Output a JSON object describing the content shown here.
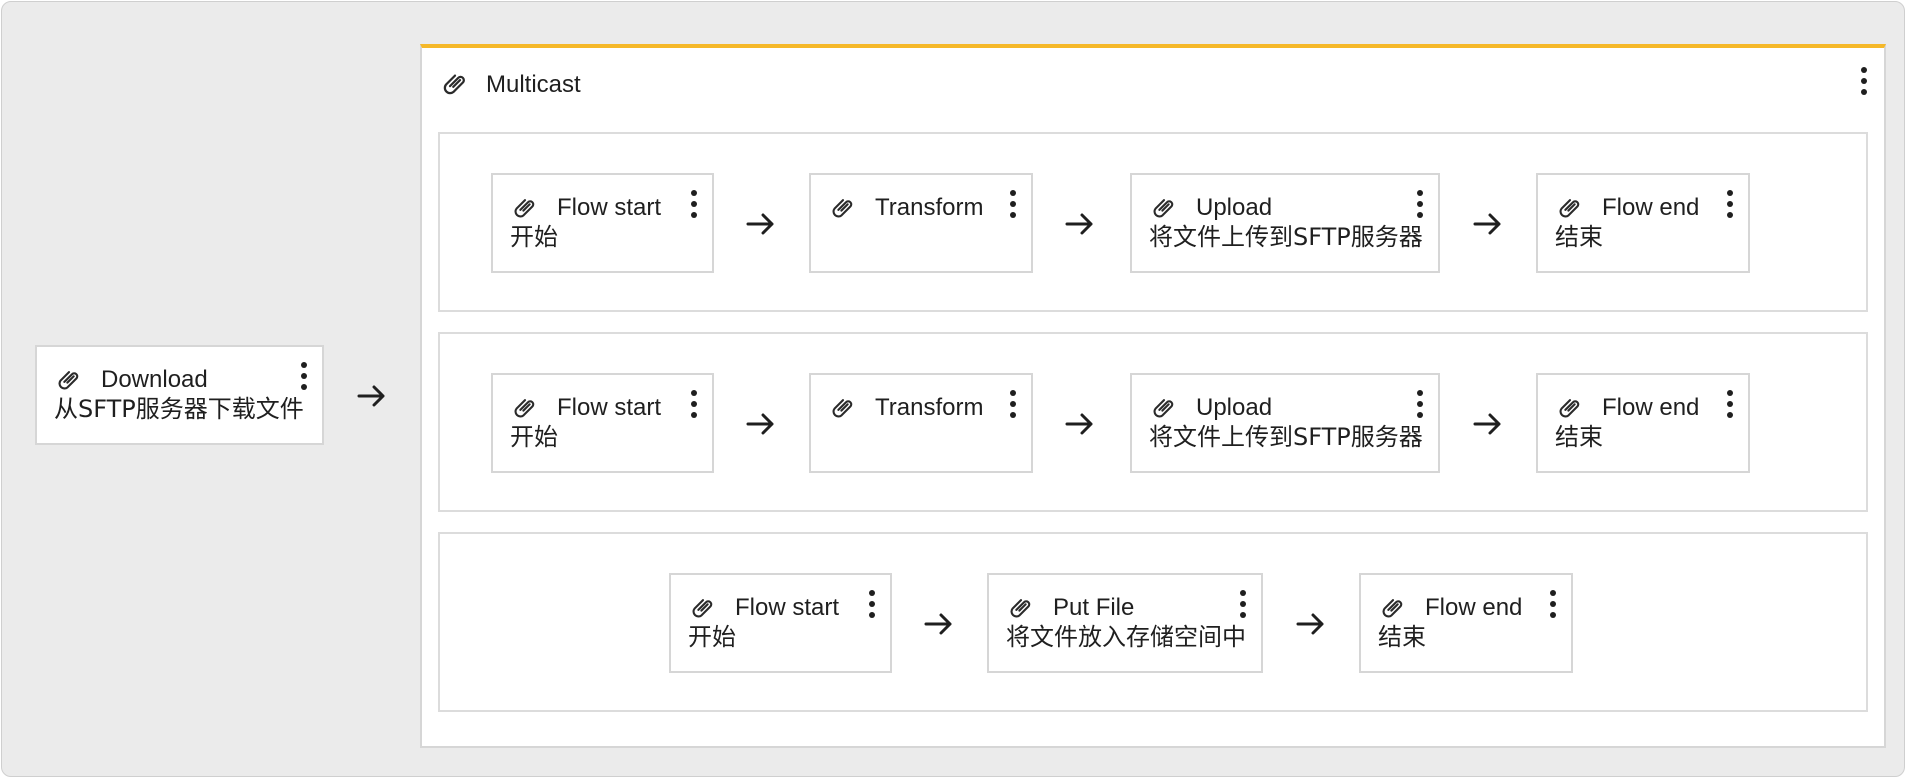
{
  "colors": {
    "accent": "#f5b829",
    "canvas_bg": "#ebebeb",
    "border": "#d6d6d6",
    "text": "#1f1f1f"
  },
  "icons": {
    "node_icon": "paperclip-icon",
    "menu_icon": "kebab-menu-icon",
    "connector": "arrow-right-icon"
  },
  "download": {
    "title": "Download",
    "subtitle": "从SFTP服务器下载文件"
  },
  "multicast": {
    "title": "Multicast",
    "branches": [
      {
        "nodes": [
          {
            "title": "Flow start",
            "subtitle": "开始"
          },
          {
            "title": "Transform",
            "subtitle": ""
          },
          {
            "title": "Upload",
            "subtitle": "将文件上传到SFTP服务器"
          },
          {
            "title": "Flow end",
            "subtitle": "结束"
          }
        ]
      },
      {
        "nodes": [
          {
            "title": "Flow start",
            "subtitle": "开始"
          },
          {
            "title": "Transform",
            "subtitle": ""
          },
          {
            "title": "Upload",
            "subtitle": "将文件上传到SFTP服务器"
          },
          {
            "title": "Flow end",
            "subtitle": "结束"
          }
        ]
      },
      {
        "nodes": [
          {
            "title": "Flow start",
            "subtitle": "开始"
          },
          {
            "title": "Put File",
            "subtitle": "将文件放入存储空间中"
          },
          {
            "title": "Flow end",
            "subtitle": "结束"
          }
        ]
      }
    ]
  }
}
